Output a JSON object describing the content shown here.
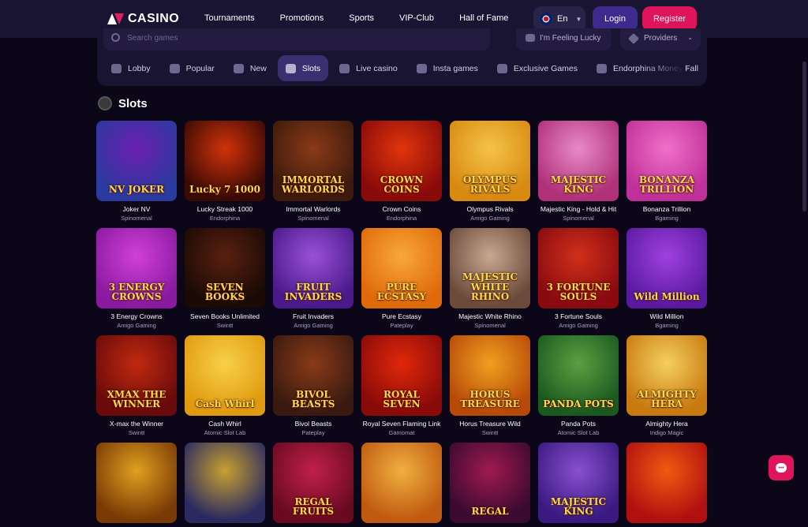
{
  "header": {
    "logo_text": "CASINO",
    "nav": [
      "Tournaments",
      "Promotions",
      "Sports",
      "VIP-Club",
      "Hall of Fame"
    ],
    "more": "···",
    "language": "En",
    "login": "Login",
    "register": "Register"
  },
  "filters": {
    "search_placeholder": "Search games",
    "lucky": "I'm Feeling Lucky",
    "providers": "Providers"
  },
  "categories": [
    "Lobby",
    "Popular",
    "New",
    "Slots",
    "Live casino",
    "Insta games",
    "Exclusive Games",
    "Endorphina Money Fall"
  ],
  "active_category": "Slots",
  "section_title": "Slots",
  "games": [
    {
      "name": "Joker NV",
      "provider": "Spinomenal",
      "art": "NV JOKER",
      "colors": [
        "#2b3a9e",
        "#6b1fb0"
      ]
    },
    {
      "name": "Lucky Streak 1000",
      "provider": "Endorphina",
      "art": "Lucky 7 1000",
      "colors": [
        "#3a0a05",
        "#d0320a"
      ]
    },
    {
      "name": "Immortal Warlords",
      "provider": "Spinomenal",
      "art": "IMMORTAL WARLORDS",
      "colors": [
        "#3d1a0c",
        "#8a3a18"
      ]
    },
    {
      "name": "Crown Coins",
      "provider": "Endorphina",
      "art": "CROWN COINS",
      "colors": [
        "#8a0a0a",
        "#e0350c"
      ]
    },
    {
      "name": "Olympus Rivals",
      "provider": "Amigo Gaming",
      "art": "OLYMPUS RIVALS",
      "colors": [
        "#d88a10",
        "#f5c34a"
      ]
    },
    {
      "name": "Majestic King - Hold & Hit",
      "provider": "Spinomenal",
      "art": "MAJESTIC KING",
      "colors": [
        "#b0307a",
        "#e88ac8"
      ]
    },
    {
      "name": "Bonanza Trillion",
      "provider": "Bgaming",
      "art": "BONANZA TRILLION",
      "colors": [
        "#c0309a",
        "#f070c8"
      ]
    },
    {
      "name": "3 Energy Crowns",
      "provider": "Amigo Gaming",
      "art": "3 ENERGY CROWNS",
      "colors": [
        "#8a1aa0",
        "#d040d8"
      ]
    },
    {
      "name": "Seven Books Unlimited",
      "provider": "Swintt",
      "art": "SEVEN BOOKS",
      "colors": [
        "#1a0a05",
        "#5a2010"
      ]
    },
    {
      "name": "Fruit Invaders",
      "provider": "Amigo Gaming",
      "art": "FRUIT INVADERS",
      "colors": [
        "#4a1a8a",
        "#9a50d8"
      ]
    },
    {
      "name": "Pure Ecstasy",
      "provider": "Pateplay",
      "art": "PURE ECSTASY",
      "colors": [
        "#e06a0a",
        "#f8a838"
      ]
    },
    {
      "name": "Majestic White Rhino",
      "provider": "Spinomenal",
      "art": "MAJESTIC WHITE RHINO",
      "colors": [
        "#6a4a3a",
        "#c8a890"
      ]
    },
    {
      "name": "3 Fortune Souls",
      "provider": "Amigo Gaming",
      "art": "3 FORTUNE SOULS",
      "colors": [
        "#8a0a10",
        "#d0301a"
      ]
    },
    {
      "name": "Wild Million",
      "provider": "Bgaming",
      "art": "Wild Million",
      "colors": [
        "#5a1aa0",
        "#a040e0"
      ]
    },
    {
      "name": "X-max the Winner",
      "provider": "Swintt",
      "art": "XMAX THE WINNER",
      "colors": [
        "#6a0a0a",
        "#c02a10"
      ]
    },
    {
      "name": "Cash Whirl",
      "provider": "Atomic Slot Lab",
      "art": "Cash Whirl",
      "colors": [
        "#e09a10",
        "#f8d048"
      ]
    },
    {
      "name": "Bivol Beasts",
      "provider": "Pateplay",
      "art": "BIVOL BEASTS",
      "colors": [
        "#3a1a10",
        "#8a3a18"
      ]
    },
    {
      "name": "Royal Seven Flaming Link",
      "provider": "Gamomat",
      "art": "ROYAL SEVEN",
      "colors": [
        "#8a0a0a",
        "#e0280a"
      ]
    },
    {
      "name": "Horus Treasure Wild",
      "provider": "Swintt",
      "art": "HORUS TREASURE",
      "colors": [
        "#b84a08",
        "#f0a020"
      ]
    },
    {
      "name": "Panda Pots",
      "provider": "Atomic Slot Lab",
      "art": "PANDA POTS",
      "colors": [
        "#1a5a20",
        "#5aa040"
      ]
    },
    {
      "name": "Almighty Hera",
      "provider": "Indigo Magic",
      "art": "ALMIGHTY HERA",
      "colors": [
        "#c87a10",
        "#f5cf60"
      ]
    },
    {
      "name": "",
      "provider": "",
      "art": "",
      "colors": [
        "#7a3a05",
        "#e0a020"
      ]
    },
    {
      "name": "",
      "provider": "",
      "art": "",
      "colors": [
        "#2a2a60",
        "#c8a030"
      ]
    },
    {
      "name": "",
      "provider": "",
      "art": "REGAL FRUITS",
      "colors": [
        "#6a0a20",
        "#c0204a"
      ]
    },
    {
      "name": "",
      "provider": "",
      "art": "",
      "colors": [
        "#c05a10",
        "#f0b040"
      ]
    },
    {
      "name": "",
      "provider": "",
      "art": "REGAL",
      "colors": [
        "#3a0a30",
        "#a01a50"
      ]
    },
    {
      "name": "",
      "provider": "",
      "art": "MAJESTIC KING",
      "colors": [
        "#3a1a80",
        "#8a50d0"
      ]
    },
    {
      "name": "",
      "provider": "",
      "art": "",
      "colors": [
        "#b01010",
        "#f05a10"
      ]
    }
  ]
}
